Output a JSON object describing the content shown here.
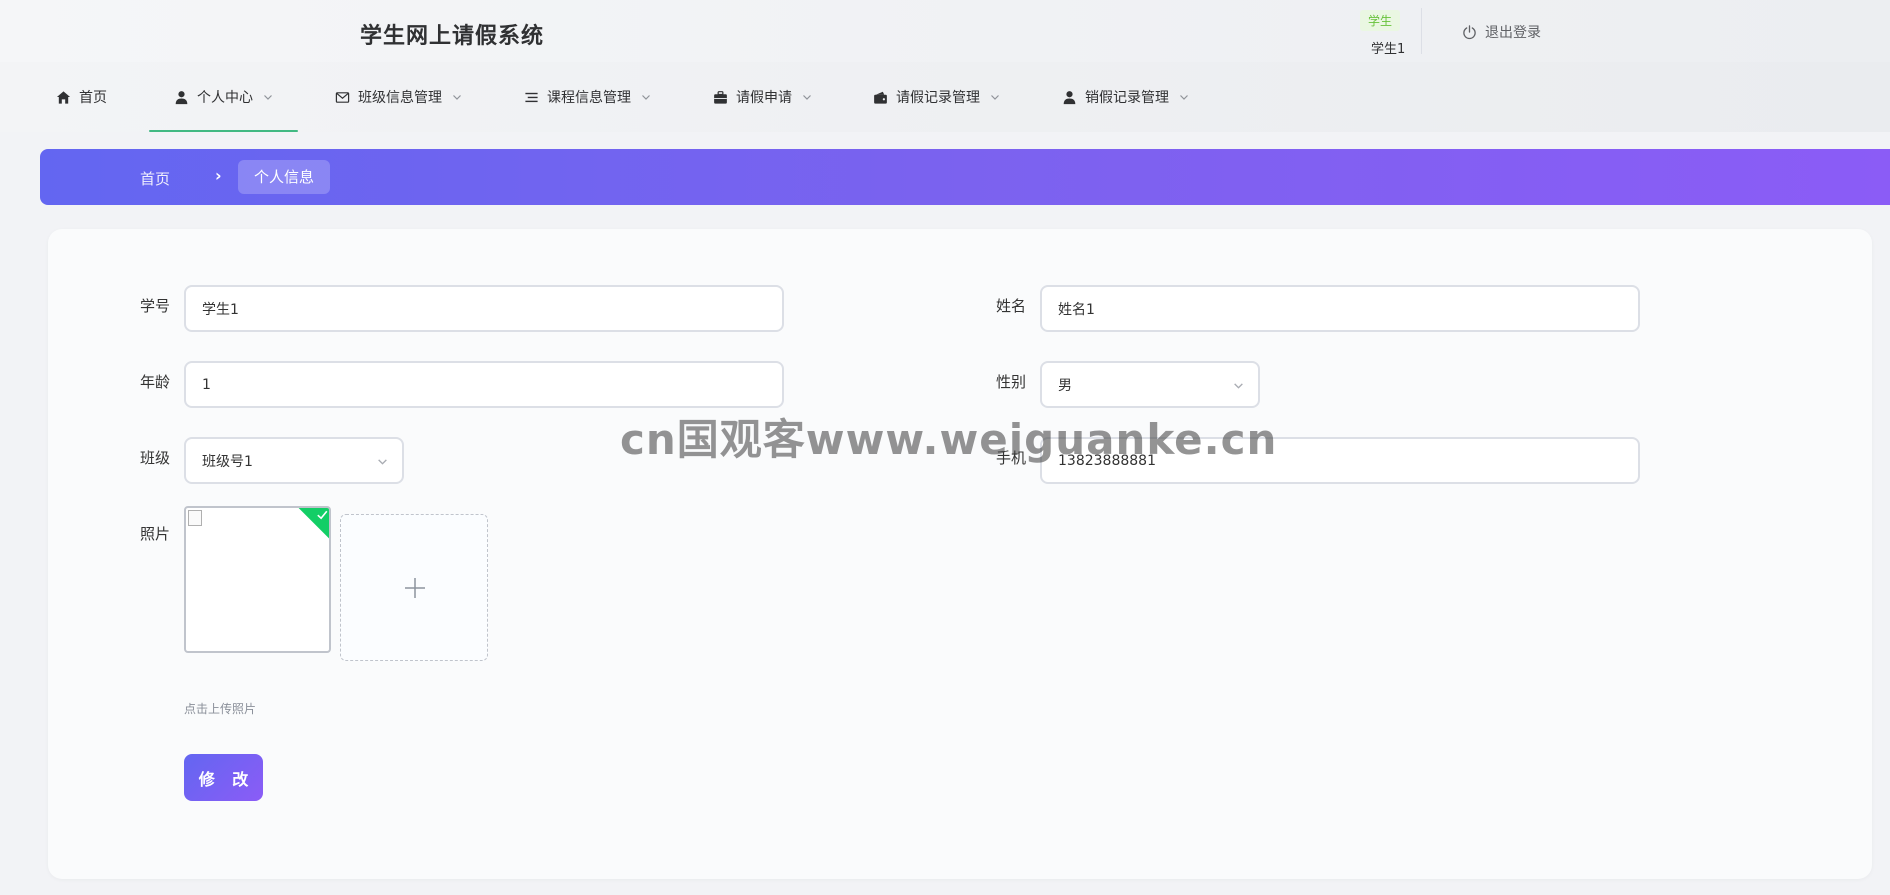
{
  "header": {
    "title": "学生网上请假系统",
    "role_badge": "学生",
    "user_name": "学生1",
    "logout_label": "退出登录"
  },
  "nav": {
    "items": [
      {
        "label": "首页",
        "icon": "home-icon"
      },
      {
        "label": "个人中心",
        "icon": "user-icon"
      },
      {
        "label": "班级信息管理",
        "icon": "mail-icon"
      },
      {
        "label": "课程信息管理",
        "icon": "list-icon"
      },
      {
        "label": "请假申请",
        "icon": "briefcase-icon"
      },
      {
        "label": "请假记录管理",
        "icon": "wallet-icon"
      },
      {
        "label": "销假记录管理",
        "icon": "user-icon"
      }
    ],
    "active_index": 1
  },
  "breadcrumb": {
    "home": "首页",
    "separator": "›",
    "current": "个人信息"
  },
  "form": {
    "student_id": {
      "label": "学号",
      "value": "学生1"
    },
    "name": {
      "label": "姓名",
      "value": "姓名1"
    },
    "age": {
      "label": "年龄",
      "value": "1"
    },
    "gender": {
      "label": "性别",
      "value": "男"
    },
    "class": {
      "label": "班级",
      "value": "班级号1"
    },
    "phone": {
      "label": "手机",
      "value": "13823888881"
    },
    "photo": {
      "label": "照片",
      "tip": "点击上传照片"
    },
    "submit_label": "修 改"
  },
  "watermark": "cn国观客www.weiguanke.cn",
  "colors": {
    "accent_start": "#6366f1",
    "accent_end": "#8b5cf6",
    "nav_active": "#42b983",
    "role_badge": "#67c23a",
    "success": "#13ce66"
  }
}
